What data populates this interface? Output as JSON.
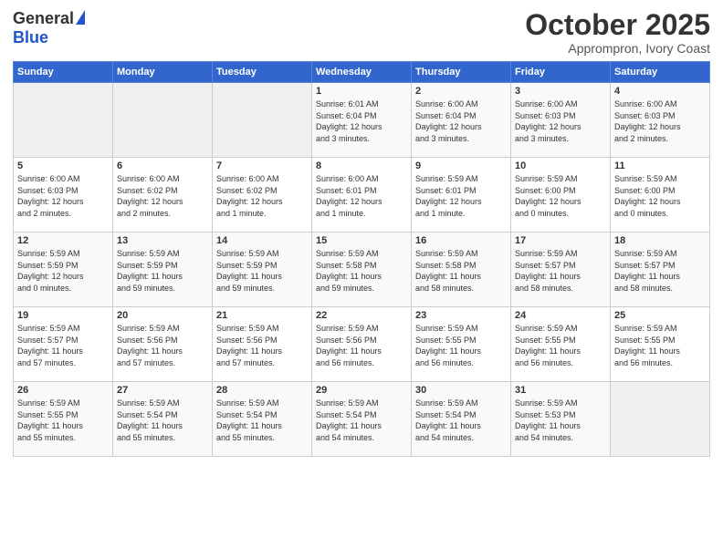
{
  "logo": {
    "general": "General",
    "blue": "Blue"
  },
  "header": {
    "month": "October 2025",
    "location": "Apprompron, Ivory Coast"
  },
  "weekdays": [
    "Sunday",
    "Monday",
    "Tuesday",
    "Wednesday",
    "Thursday",
    "Friday",
    "Saturday"
  ],
  "weeks": [
    [
      {
        "day": "",
        "info": ""
      },
      {
        "day": "",
        "info": ""
      },
      {
        "day": "",
        "info": ""
      },
      {
        "day": "1",
        "info": "Sunrise: 6:01 AM\nSunset: 6:04 PM\nDaylight: 12 hours\nand 3 minutes."
      },
      {
        "day": "2",
        "info": "Sunrise: 6:00 AM\nSunset: 6:04 PM\nDaylight: 12 hours\nand 3 minutes."
      },
      {
        "day": "3",
        "info": "Sunrise: 6:00 AM\nSunset: 6:03 PM\nDaylight: 12 hours\nand 3 minutes."
      },
      {
        "day": "4",
        "info": "Sunrise: 6:00 AM\nSunset: 6:03 PM\nDaylight: 12 hours\nand 2 minutes."
      }
    ],
    [
      {
        "day": "5",
        "info": "Sunrise: 6:00 AM\nSunset: 6:03 PM\nDaylight: 12 hours\nand 2 minutes."
      },
      {
        "day": "6",
        "info": "Sunrise: 6:00 AM\nSunset: 6:02 PM\nDaylight: 12 hours\nand 2 minutes."
      },
      {
        "day": "7",
        "info": "Sunrise: 6:00 AM\nSunset: 6:02 PM\nDaylight: 12 hours\nand 1 minute."
      },
      {
        "day": "8",
        "info": "Sunrise: 6:00 AM\nSunset: 6:01 PM\nDaylight: 12 hours\nand 1 minute."
      },
      {
        "day": "9",
        "info": "Sunrise: 5:59 AM\nSunset: 6:01 PM\nDaylight: 12 hours\nand 1 minute."
      },
      {
        "day": "10",
        "info": "Sunrise: 5:59 AM\nSunset: 6:00 PM\nDaylight: 12 hours\nand 0 minutes."
      },
      {
        "day": "11",
        "info": "Sunrise: 5:59 AM\nSunset: 6:00 PM\nDaylight: 12 hours\nand 0 minutes."
      }
    ],
    [
      {
        "day": "12",
        "info": "Sunrise: 5:59 AM\nSunset: 5:59 PM\nDaylight: 12 hours\nand 0 minutes."
      },
      {
        "day": "13",
        "info": "Sunrise: 5:59 AM\nSunset: 5:59 PM\nDaylight: 11 hours\nand 59 minutes."
      },
      {
        "day": "14",
        "info": "Sunrise: 5:59 AM\nSunset: 5:59 PM\nDaylight: 11 hours\nand 59 minutes."
      },
      {
        "day": "15",
        "info": "Sunrise: 5:59 AM\nSunset: 5:58 PM\nDaylight: 11 hours\nand 59 minutes."
      },
      {
        "day": "16",
        "info": "Sunrise: 5:59 AM\nSunset: 5:58 PM\nDaylight: 11 hours\nand 58 minutes."
      },
      {
        "day": "17",
        "info": "Sunrise: 5:59 AM\nSunset: 5:57 PM\nDaylight: 11 hours\nand 58 minutes."
      },
      {
        "day": "18",
        "info": "Sunrise: 5:59 AM\nSunset: 5:57 PM\nDaylight: 11 hours\nand 58 minutes."
      }
    ],
    [
      {
        "day": "19",
        "info": "Sunrise: 5:59 AM\nSunset: 5:57 PM\nDaylight: 11 hours\nand 57 minutes."
      },
      {
        "day": "20",
        "info": "Sunrise: 5:59 AM\nSunset: 5:56 PM\nDaylight: 11 hours\nand 57 minutes."
      },
      {
        "day": "21",
        "info": "Sunrise: 5:59 AM\nSunset: 5:56 PM\nDaylight: 11 hours\nand 57 minutes."
      },
      {
        "day": "22",
        "info": "Sunrise: 5:59 AM\nSunset: 5:56 PM\nDaylight: 11 hours\nand 56 minutes."
      },
      {
        "day": "23",
        "info": "Sunrise: 5:59 AM\nSunset: 5:55 PM\nDaylight: 11 hours\nand 56 minutes."
      },
      {
        "day": "24",
        "info": "Sunrise: 5:59 AM\nSunset: 5:55 PM\nDaylight: 11 hours\nand 56 minutes."
      },
      {
        "day": "25",
        "info": "Sunrise: 5:59 AM\nSunset: 5:55 PM\nDaylight: 11 hours\nand 56 minutes."
      }
    ],
    [
      {
        "day": "26",
        "info": "Sunrise: 5:59 AM\nSunset: 5:55 PM\nDaylight: 11 hours\nand 55 minutes."
      },
      {
        "day": "27",
        "info": "Sunrise: 5:59 AM\nSunset: 5:54 PM\nDaylight: 11 hours\nand 55 minutes."
      },
      {
        "day": "28",
        "info": "Sunrise: 5:59 AM\nSunset: 5:54 PM\nDaylight: 11 hours\nand 55 minutes."
      },
      {
        "day": "29",
        "info": "Sunrise: 5:59 AM\nSunset: 5:54 PM\nDaylight: 11 hours\nand 54 minutes."
      },
      {
        "day": "30",
        "info": "Sunrise: 5:59 AM\nSunset: 5:54 PM\nDaylight: 11 hours\nand 54 minutes."
      },
      {
        "day": "31",
        "info": "Sunrise: 5:59 AM\nSunset: 5:53 PM\nDaylight: 11 hours\nand 54 minutes."
      },
      {
        "day": "",
        "info": ""
      }
    ]
  ]
}
